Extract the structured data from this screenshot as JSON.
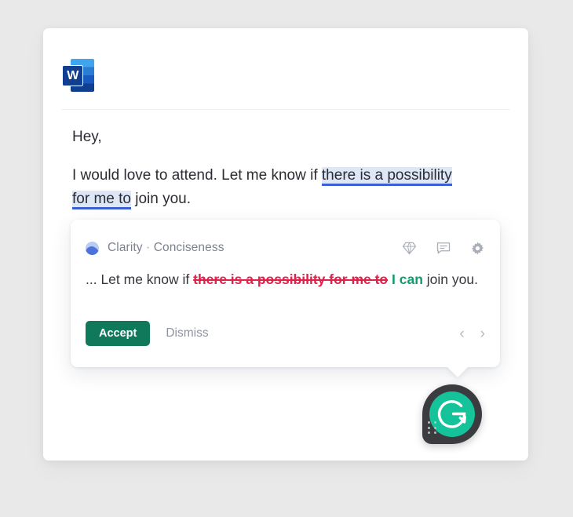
{
  "app": {
    "icon_name": "microsoft-word-icon",
    "icon_letter": "W"
  },
  "document": {
    "greeting": "Hey,",
    "paragraph": {
      "lead": "I would love to attend. Let me know if ",
      "highlight_1": "there is a possibility",
      "highlight_2": "for me to",
      "tail": " join you."
    }
  },
  "suggestion": {
    "category_primary": "Clarity",
    "category_separator": " · ",
    "category_secondary": "Conciseness",
    "icons": {
      "premium": "diamond-icon",
      "feedback": "comment-icon",
      "settings": "gear-icon"
    },
    "text": {
      "prefix": "... Let me know if ",
      "removed": "there is a possibility for me to",
      "added": "I can",
      "suffix": " join you."
    },
    "accept_label": "Accept",
    "dismiss_label": "Dismiss",
    "nav": {
      "prev": "‹",
      "next": "›"
    }
  },
  "assistant_button": {
    "name": "grammarly-button",
    "logo": "grammarly-g-icon"
  },
  "colors": {
    "page_background": "#e9e9ea",
    "document_background": "#ffffff",
    "highlight_background": "#dde7f6",
    "highlight_underline": "#3c5fd4",
    "removed_text": "#e0214a",
    "added_text": "#0f9d6e",
    "accept_button": "#11795b",
    "grammarly_green": "#15c39a",
    "grammarly_dark": "#3b3c40"
  }
}
